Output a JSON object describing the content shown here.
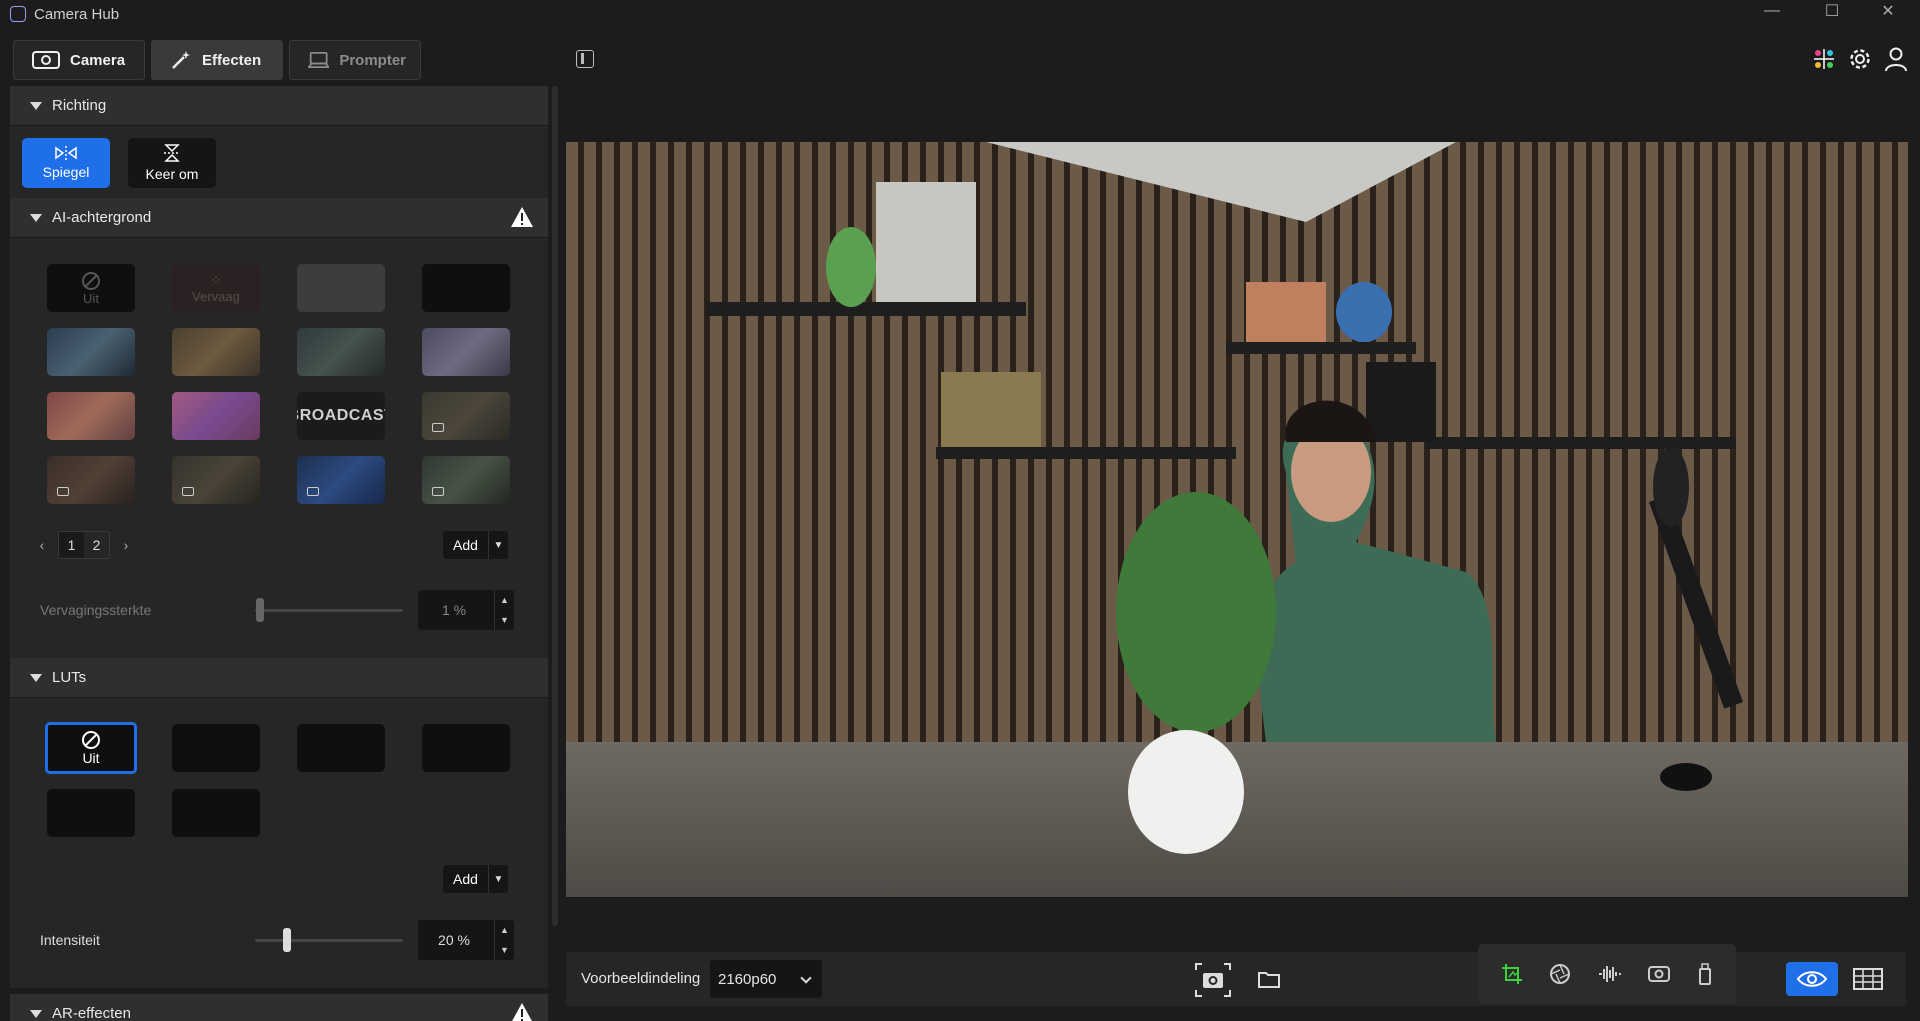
{
  "window": {
    "title": "Camera Hub"
  },
  "tabs": [
    {
      "label": "Camera"
    },
    {
      "label": "Effecten"
    },
    {
      "label": "Prompter"
    }
  ],
  "sections": {
    "richting": {
      "title": "Richting",
      "buttons": [
        {
          "label": "Spiegel",
          "active": true
        },
        {
          "label": "Keer om",
          "active": false
        }
      ]
    },
    "ai_background": {
      "title": "AI-achtergrond",
      "tiles": [
        "Uit",
        "Vervaag",
        "BROADCAST"
      ],
      "pages": [
        "1",
        "2"
      ],
      "add_label": "Add",
      "slider": {
        "label": "Vervagingssterkte",
        "value_text": "1 %",
        "value": 0.01
      }
    },
    "luts": {
      "title": "LUTs",
      "tiles": [
        "Uit"
      ],
      "add_label": "Add",
      "slider": {
        "label": "Intensiteit",
        "value_text": "20 %",
        "value": 0.2
      }
    },
    "ar": {
      "title": "AR-effecten"
    }
  },
  "bottombar": {
    "preview_label": "Voorbeeldindeling",
    "format_value": "2160p60"
  },
  "colors": {
    "accent": "#1f6feb",
    "green": "#3cd23c"
  }
}
